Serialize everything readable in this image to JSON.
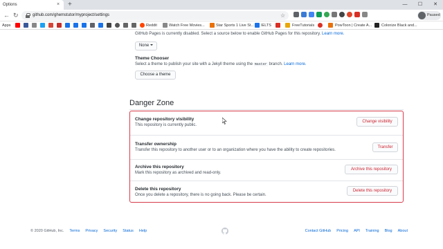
{
  "browser": {
    "tab_title": "Options",
    "tab_close": "×",
    "new_tab": "+",
    "url": "github.com/ghemstutor/myproject/settings",
    "profile_label": "Paused",
    "controls": {
      "minimize": "—",
      "maximize": "☐",
      "close": "✕"
    },
    "bookmarks": [
      {
        "label": "Apps"
      },
      {
        "label": "Reddit"
      },
      {
        "label": "Watch Free Movies..."
      },
      {
        "label": "Star Sports 1 Live St..."
      },
      {
        "label": "IELTS"
      },
      {
        "label": "FreeTutorials"
      },
      {
        "label": "PowToon | Create A..."
      },
      {
        "label": "Colonize Black and..."
      }
    ]
  },
  "pages": {
    "status_text": "GitHub Pages is currently disabled. Select a source below to enable GitHub Pages for this repository.",
    "learn_more": "Learn more.",
    "source_button": "None",
    "theme_title": "Theme Chooser",
    "theme_desc_before": "Select a theme to publish your site with a Jekyll theme using the",
    "theme_desc_code": "master",
    "theme_desc_after": "branch.",
    "theme_learn_more": "Learn more.",
    "choose_theme_button": "Choose a theme"
  },
  "danger_zone": {
    "title": "Danger Zone",
    "rows": [
      {
        "title": "Change repository visibility",
        "desc": "This repository is currently public.",
        "button": "Change visibility"
      },
      {
        "title": "Transfer ownership",
        "desc": "Transfer this repository to another user or to an organization where you have the ability to create repositories.",
        "button": "Transfer"
      },
      {
        "title": "Archive this repository",
        "desc": "Mark this repository as archived and read-only.",
        "button": "Archive this repository"
      },
      {
        "title": "Delete this repository",
        "desc": "Once you delete a repository, there is no going back. Please be certain.",
        "button": "Delete this repository"
      }
    ]
  },
  "footer": {
    "copyright": "© 2020 GitHub, Inc.",
    "left_links": [
      "Terms",
      "Privacy",
      "Security",
      "Status",
      "Help"
    ],
    "right_links": [
      "Contact GitHub",
      "Pricing",
      "API",
      "Training",
      "Blog",
      "About"
    ]
  },
  "colors": {
    "danger": "#d73a49",
    "link": "#0366d6"
  }
}
